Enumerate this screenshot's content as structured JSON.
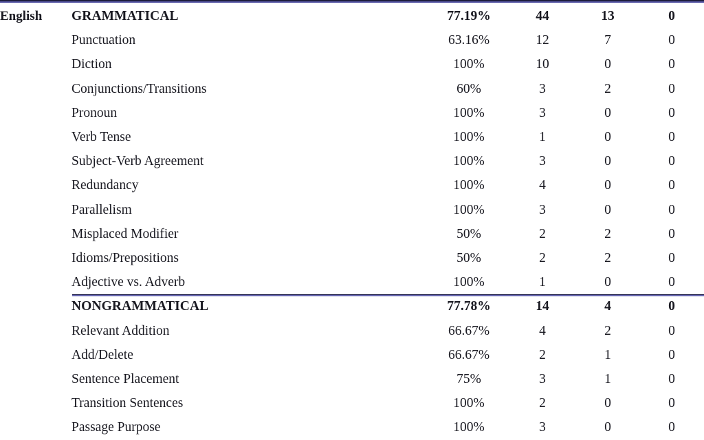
{
  "table": {
    "language_label": "English",
    "rules": {
      "top_rule_dark": "#1d1d3c",
      "top_rule_blue": "#5a5aa8",
      "mid_rule_dark": "#23234a",
      "mid_rule_blue": "#6565ae"
    },
    "sections": [
      {
        "heading": {
          "label": "GRAMMATICAL",
          "percent": "77.19%",
          "correct": "44",
          "incorrect": "13",
          "omitted": "0"
        },
        "rows": [
          {
            "label": "Punctuation",
            "percent": "63.16%",
            "correct": "12",
            "incorrect": "7",
            "omitted": "0"
          },
          {
            "label": "Diction",
            "percent": "100%",
            "correct": "10",
            "incorrect": "0",
            "omitted": "0"
          },
          {
            "label": "Conjunctions/Transitions",
            "percent": "60%",
            "correct": "3",
            "incorrect": "2",
            "omitted": "0"
          },
          {
            "label": "Pronoun",
            "percent": "100%",
            "correct": "3",
            "incorrect": "0",
            "omitted": "0"
          },
          {
            "label": "Verb Tense",
            "percent": "100%",
            "correct": "1",
            "incorrect": "0",
            "omitted": "0"
          },
          {
            "label": "Subject-Verb Agreement",
            "percent": "100%",
            "correct": "3",
            "incorrect": "0",
            "omitted": "0"
          },
          {
            "label": "Redundancy",
            "percent": "100%",
            "correct": "4",
            "incorrect": "0",
            "omitted": "0"
          },
          {
            "label": "Parallelism",
            "percent": "100%",
            "correct": "3",
            "incorrect": "0",
            "omitted": "0"
          },
          {
            "label": "Misplaced Modifier",
            "percent": "50%",
            "correct": "2",
            "incorrect": "2",
            "omitted": "0"
          },
          {
            "label": "Idioms/Prepositions",
            "percent": "50%",
            "correct": "2",
            "incorrect": "2",
            "omitted": "0"
          },
          {
            "label": "Adjective vs. Adverb",
            "percent": "100%",
            "correct": "1",
            "incorrect": "0",
            "omitted": "0"
          }
        ]
      },
      {
        "heading": {
          "label": "NONGRAMMATICAL",
          "percent": "77.78%",
          "correct": "14",
          "incorrect": "4",
          "omitted": "0"
        },
        "rows": [
          {
            "label": "Relevant Addition",
            "percent": "66.67%",
            "correct": "4",
            "incorrect": "2",
            "omitted": "0"
          },
          {
            "label": "Add/Delete",
            "percent": "66.67%",
            "correct": "2",
            "incorrect": "1",
            "omitted": "0"
          },
          {
            "label": "Sentence Placement",
            "percent": "75%",
            "correct": "3",
            "incorrect": "1",
            "omitted": "0"
          },
          {
            "label": "Transition Sentences",
            "percent": "100%",
            "correct": "2",
            "incorrect": "0",
            "omitted": "0"
          },
          {
            "label": "Passage Purpose",
            "percent": "100%",
            "correct": "3",
            "incorrect": "0",
            "omitted": "0"
          }
        ]
      }
    ]
  }
}
